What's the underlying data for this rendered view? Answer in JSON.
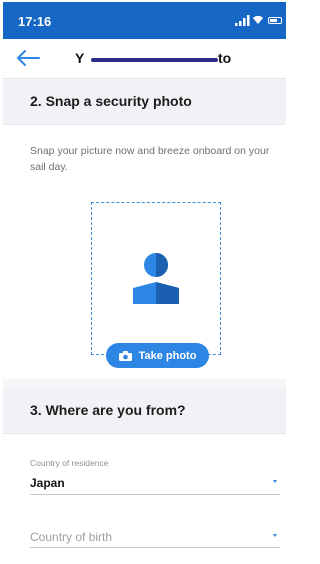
{
  "status_bar": {
    "time": "17:16",
    "icons": [
      "cellular-signal-icon",
      "wifi-icon",
      "battery-icon"
    ]
  },
  "nav": {
    "back_icon": "arrow-left-icon",
    "title_prefix": "Y",
    "title_suffix": "to"
  },
  "section_photo": {
    "heading": "2. Snap a security photo",
    "description": "Snap your picture now and breeze onboard on your sail day.",
    "placeholder_icon": "person-silhouette-icon",
    "button_icon": "camera-icon",
    "button_label": "Take photo"
  },
  "section_origin": {
    "heading": "3. Where are you from?",
    "residence": {
      "label": "Country of residence",
      "value": "Japan"
    },
    "birth": {
      "placeholder": "Country of birth"
    }
  },
  "colors": {
    "accent": "#2d86e3",
    "status_bar": "#1666c5",
    "redaction": "#2e2c8a"
  }
}
